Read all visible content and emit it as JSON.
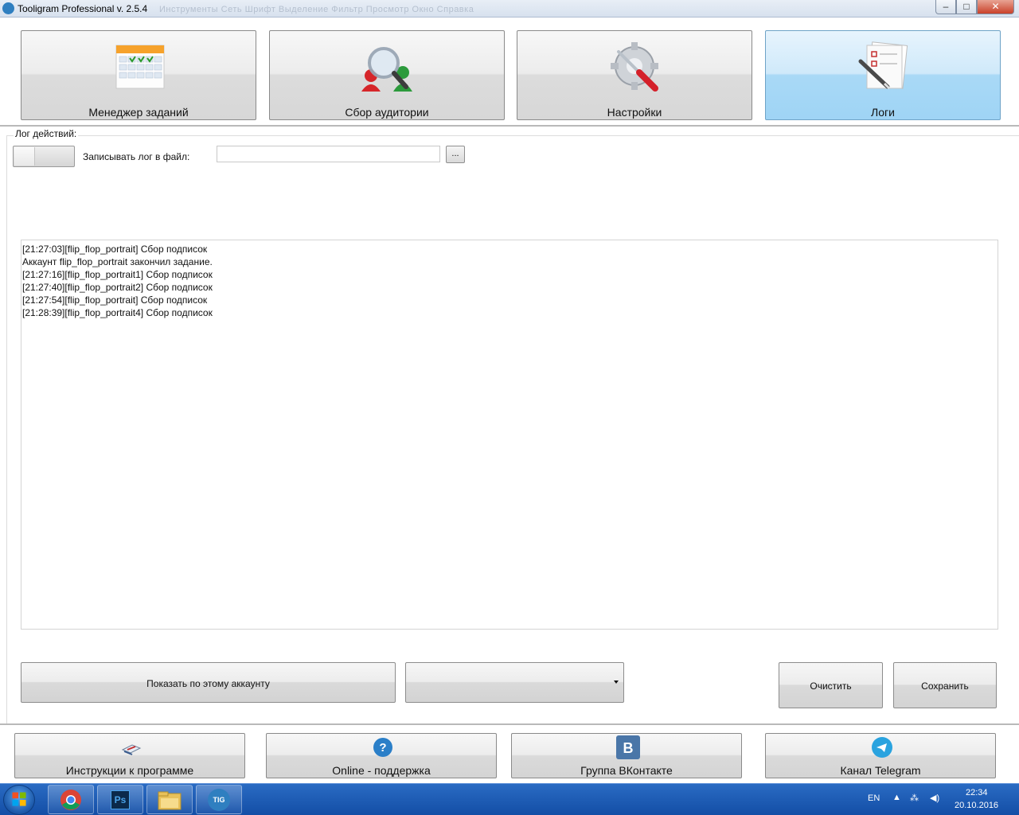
{
  "window": {
    "title": "Tooligram Professional v. 2.5.4",
    "ghost_menu": "Инструменты   Сеть   Шрифт   Выделение   Фильтр   Просмотр   Окно   Справка",
    "minimize": "–",
    "maximize": "□",
    "close": "✕"
  },
  "topnav": {
    "items": [
      {
        "label": "Менеджер заданий",
        "icon": "calendar-icon",
        "active": false
      },
      {
        "label": "Сбор аудитории",
        "icon": "magnifier-users-icon",
        "active": false
      },
      {
        "label": "Настройки",
        "icon": "gear-screwdriver-icon",
        "active": false
      },
      {
        "label": "Логи",
        "icon": "checklist-pen-icon",
        "active": true
      }
    ]
  },
  "logs": {
    "group_title": "Лог действий:",
    "write_to_file_label": "Записывать лог в файл:",
    "file_path_value": "",
    "browse_label": "...",
    "lines": [
      "[21:27:03][flip_flop_portrait] Сбор подписок",
      "Аккаунт flip_flop_portrait закончил задание.",
      "[21:27:16][flip_flop_portrait1] Сбор подписок",
      "[21:27:40][flip_flop_portrait2] Сбор подписок",
      "[21:27:54][flip_flop_portrait] Сбор подписок",
      "[21:28:39][flip_flop_portrait4] Сбор подписок"
    ],
    "show_by_account_label": "Показать по этому аккаунту",
    "account_select_value": "",
    "clear_label": "Очистить",
    "save_label": "Сохранить"
  },
  "bottomnav": {
    "items": [
      {
        "label": "Инструкции к программе",
        "icon": "instructions-icon"
      },
      {
        "label": "Online - поддержка",
        "icon": "help-icon"
      },
      {
        "label": "Группа ВКонтакте",
        "icon": "vk-icon"
      },
      {
        "label": "Канал Telegram",
        "icon": "telegram-icon"
      }
    ]
  },
  "taskbar": {
    "language": "EN",
    "time": "22:34",
    "date": "20.10.2016",
    "ps_label": "Ps",
    "tig_label": "TIG"
  },
  "colors": {
    "active_tab": "#a9d9f6",
    "taskbar": "#1f5fb8",
    "help_blue": "#2b7fc8",
    "vk_blue": "#4a76a8",
    "telegram_blue": "#2aa3df"
  }
}
